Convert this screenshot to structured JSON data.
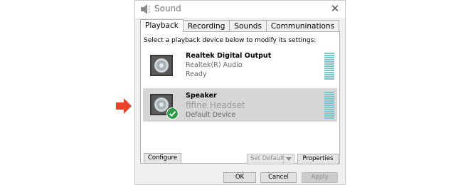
{
  "window": {
    "title": "Sound",
    "icon": "speaker-icon",
    "close_icon": "close-icon"
  },
  "tabs": [
    {
      "label": "Playback",
      "active": true
    },
    {
      "label": "Recording",
      "active": false
    },
    {
      "label": "Sounds",
      "active": false
    },
    {
      "label": "Communinations",
      "active": false
    }
  ],
  "instruction": "Select a playback device below to modify its settings:",
  "devices": [
    {
      "name": "Realtek Digital Output",
      "driver": "Realtek(R) Audio",
      "status": "Ready",
      "selected": false,
      "default_badge": false
    },
    {
      "name": "Speaker",
      "driver": "fifine Headset",
      "status": "Default Device",
      "selected": true,
      "default_badge": true
    }
  ],
  "panel_buttons": {
    "configure": "Configure",
    "set_default": "Set Default",
    "properties": "Properties"
  },
  "footer": {
    "ok": "OK",
    "cancel": "Cancel",
    "apply": "Apply"
  },
  "colors": {
    "annotation_arrow": "#e8412c",
    "meter": "#7ec6cf",
    "check_badge": "#2e9a47",
    "selection": "#d6d6d6"
  }
}
